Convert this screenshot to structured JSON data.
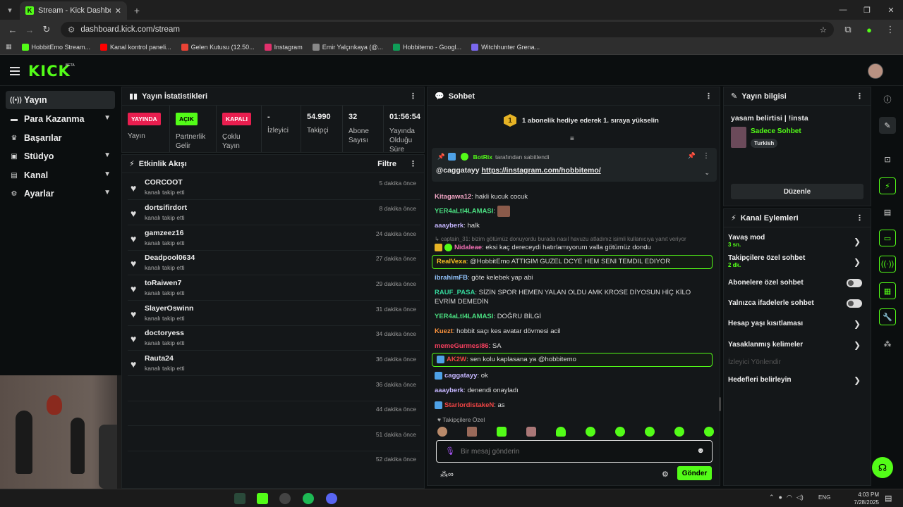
{
  "browser": {
    "tab_title": "Stream - Kick Dashboard",
    "url": "dashboard.kick.com/stream",
    "bookmarks": [
      {
        "label": "HobbitEmo Stream...",
        "color": "#53fc18"
      },
      {
        "label": "Kanal kontrol paneli...",
        "color": "#ff0000"
      },
      {
        "label": "Gelen Kutusu (12.50...",
        "color": "#ea4335"
      },
      {
        "label": "Instagram",
        "color": "#e1306c"
      },
      {
        "label": "Emir Yalçınkaya (@...",
        "color": "#888888"
      },
      {
        "label": "Hobbitemo - Googl...",
        "color": "#0f9d58"
      },
      {
        "label": "Witchhunter Grena...",
        "color": "#7b68ee"
      }
    ]
  },
  "header": {
    "logo": "KICK",
    "beta": "BETA"
  },
  "sidebar": {
    "items": [
      {
        "label": "Yayın",
        "icon": "broadcast-icon",
        "active": true
      },
      {
        "label": "Para Kazanma",
        "icon": "money-icon"
      },
      {
        "label": "Başarılar",
        "icon": "trophy-icon"
      },
      {
        "label": "Stüdyo",
        "icon": "studio-icon"
      },
      {
        "label": "Kanal",
        "icon": "channel-icon"
      },
      {
        "label": "Ayarlar",
        "icon": "gear-icon"
      }
    ]
  },
  "stats": {
    "title": "Yayın İstatistikleri",
    "cols": [
      {
        "value": "YAYINDA",
        "label": "Yayın",
        "badge_color": "#e91e4f"
      },
      {
        "value": "AÇIK",
        "label": "Partnerlik Gelir",
        "badge_color": "#53fc18"
      },
      {
        "value": "KAPALI",
        "label": "Çoklu Yayın",
        "badge_color": "#e91e4f"
      },
      {
        "value": "-",
        "label": "İzleyici"
      },
      {
        "value": "54.990",
        "label": "Takipçi"
      },
      {
        "value": "32",
        "label": "Abone Sayısı"
      },
      {
        "value": "01:56:54",
        "label": "Yayında Olduğu Süre"
      }
    ]
  },
  "activity": {
    "title": "Etkinlik Akışı",
    "filter": "Filtre",
    "events": [
      {
        "name": "CORCOOT",
        "sub": "kanalı takip etti",
        "time": "5 dakika önce"
      },
      {
        "name": "dortsifirdort",
        "sub": "kanalı takip etti",
        "time": "8 dakika önce"
      },
      {
        "name": "gamzeez16",
        "sub": "kanalı takip etti",
        "time": "24 dakika önce"
      },
      {
        "name": "Deadpool0634",
        "sub": "kanalı takip etti",
        "time": "27 dakika önce"
      },
      {
        "name": "toRaiwen7",
        "sub": "kanalı takip etti",
        "time": "29 dakika önce"
      },
      {
        "name": "SlayerOswinn",
        "sub": "kanalı takip etti",
        "time": "31 dakika önce"
      },
      {
        "name": "doctoryess",
        "sub": "kanalı takip etti",
        "time": "34 dakika önce"
      },
      {
        "name": "Rauta24",
        "sub": "kanalı takip etti",
        "time": "36 dakika önce"
      },
      {
        "name": "",
        "sub": "",
        "time": "36 dakika önce"
      },
      {
        "name": "",
        "sub": "",
        "time": "44 dakika önce"
      },
      {
        "name": "",
        "sub": "",
        "time": "51 dakika önce"
      },
      {
        "name": "",
        "sub": "",
        "time": "52 dakika önce"
      }
    ]
  },
  "chat": {
    "title": "Sohbet",
    "sub_goal": "1 abonelik hediye ederek 1. sıraya yükselin",
    "sub_goal_num": "1",
    "pinned_by": "BotRix",
    "pinned_suffix": "tarafından sabitlendi",
    "pinned_mention": "@caggatayy",
    "pinned_link": "https://instagram.com/hobbitemo/",
    "messages": [
      {
        "user": "Kitagawa12",
        "color": "#f4a7c6",
        "text": "hakli kucuk cocuk"
      },
      {
        "user": "YER4aLtI4LAMASI",
        "color": "#4ade80",
        "text": ""
      },
      {
        "user": "aaayberk",
        "color": "#c4b5fd",
        "text": "halk"
      },
      {
        "user": "captain_31",
        "color": "#777777",
        "text": "bizim götümüz donuyordu burada nasıl havuzu atladınız isimli kullanıcıya yanıt veriyor"
      },
      {
        "user": "Nidaleae",
        "color": "#f472b6",
        "text": "eksi kaç dereceydi hatırlamıyorum valla götümüz dondu"
      },
      {
        "user": "RealVexa",
        "color": "#fbbf24",
        "text": "@HobbitEmo ATTIGIM GUZEL DCYE HEM SENI TEMDIL EDIYOR"
      },
      {
        "user": "ibrahimFB",
        "color": "#93c5fd",
        "text": "göte kelebek yap abi"
      },
      {
        "user": "RAUF_PASA",
        "color": "#34d399",
        "text": "SİZİN SPOR HEMEN YALAN OLDU AMK KROSE DİYOSUN HİÇ KİLO EVRİM DEMEDİN"
      },
      {
        "user": "YER4aLtI4LAMASI",
        "color": "#4ade80",
        "text": "DOĞRU BİLGİ"
      },
      {
        "user": "Kuezt",
        "color": "#fb923c",
        "text": "hobbit saçı kes avatar dövmesi acil"
      },
      {
        "user": "memeGurmesi86",
        "color": "#f43f5e",
        "text": "SA"
      },
      {
        "user": "AK2W",
        "color": "#ef4444",
        "text": "sen kolu kaplasana ya @hobbitemo"
      },
      {
        "user": "caggatayy",
        "color": "#c4b5fd",
        "text": "ok"
      },
      {
        "user": "aaayberk",
        "color": "#c4b5fd",
        "text": "denendi onayladı"
      },
      {
        "user": "StarlordistakeN",
        "color": "#ef4444",
        "text": "as"
      }
    ],
    "followers_only_label": "Takipçilere Özel",
    "input_placeholder": "Bir mesaj gönderin",
    "send_label": "Gönder"
  },
  "stream_info": {
    "title": "Yayın bilgisi",
    "stream_title": "yasam belirtisi | !insta",
    "category": "Sadece Sohbet",
    "language": "Turkish",
    "edit_label": "Düzenle"
  },
  "channel_actions": {
    "title": "Kanal Eylemleri",
    "items": [
      {
        "label": "Yavaş mod",
        "sub": "3 sn.",
        "type": "arrow"
      },
      {
        "label": "Takipçilere özel sohbet",
        "sub": "2 dk.",
        "type": "arrow"
      },
      {
        "label": "Abonelere özel sohbet",
        "sub": "",
        "type": "toggle"
      },
      {
        "label": "Yalnızca ifadelerle sohbet",
        "sub": "",
        "type": "toggle"
      },
      {
        "label": "Hesap yaşı kısıtlaması",
        "sub": "",
        "type": "arrow"
      },
      {
        "label": "Yasaklanmış kelimeler",
        "sub": "",
        "type": "arrow"
      },
      {
        "label": "İzleyici Yönlendir",
        "sub": "",
        "type": "disabled"
      },
      {
        "label": "Hedefleri belirleyin",
        "sub": "",
        "type": "arrow"
      }
    ]
  },
  "taskbar": {
    "time": "4:03 PM",
    "date": "7/28/2025",
    "lang": "ENG"
  }
}
